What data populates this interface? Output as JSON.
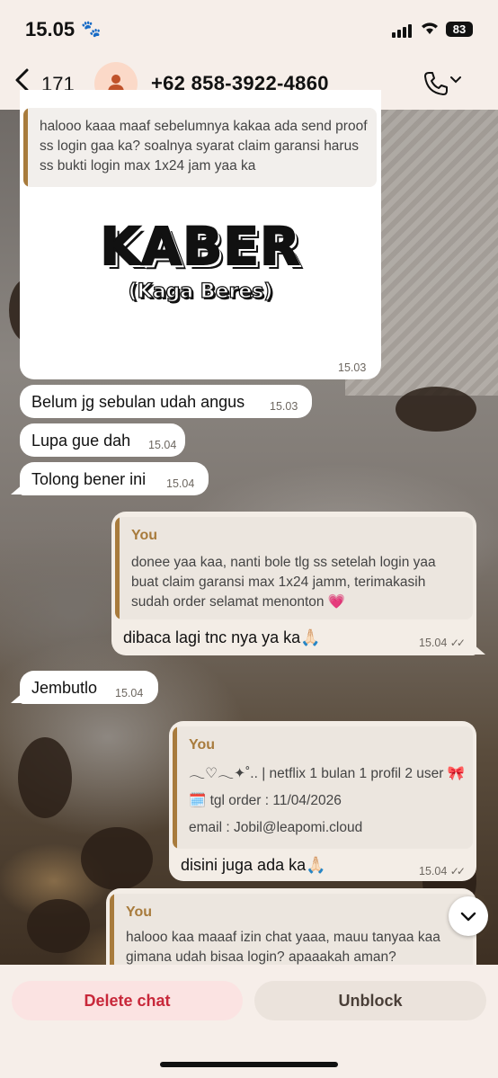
{
  "status": {
    "time": "15.05",
    "battery": "83"
  },
  "header": {
    "back_count": "171",
    "contact": "+62 858-3922-4860"
  },
  "messages": {
    "m1_quote": "halooo kaaa maaf sebelumnya kakaa ada send proof ss login gaa ka? soalnya syarat claim garansi harus ss bukti login max 1x24 jam yaa ka",
    "m1_sticker_title": "KABER",
    "m1_sticker_sub": "(Kaga Beres)",
    "m1_time": "15.03",
    "m2_text": "Belum jg sebulan udah angus",
    "m2_time": "15.03",
    "m3_text": "Lupa gue dah",
    "m3_time": "15.04",
    "m4_text": "Tolong bener ini",
    "m4_time": "15.04",
    "m5_author": "You",
    "m5_quote": "donee yaa kaa, nanti bole tlg ss setelah login yaa buat claim garansi max 1x24 jamm, terimakasih sudah order selamat menonton 💗",
    "m5_text": "dibaca lagi tnc nya ya ka🙏🏻",
    "m5_time": "15.04",
    "m6_text": "Jembutlo",
    "m6_time": "15.04",
    "m7_author": "You",
    "m7_quote_line1": "𓂃♡𓂃✦˚.. | netflix 1 bulan 1 profil 2 user 🎀",
    "m7_quote_line2": "🗓️ tgl order : 11/04/2026",
    "m7_quote_line3": "email : Jobil@leapomi.cloud",
    "m7_text": "disini juga ada ka🙏🏻",
    "m7_time": "15.04",
    "m8_author": "You",
    "m8_quote": "halooo kaa maaaf izin chat yaaa, mauu tanyaa kaa gimana udah bisaa login? apaaakah aman?"
  },
  "actions": {
    "delete": "Delete chat",
    "unblock": "Unblock"
  },
  "colors": {
    "accent": "#a87b3c",
    "delete": "#c8283a"
  }
}
